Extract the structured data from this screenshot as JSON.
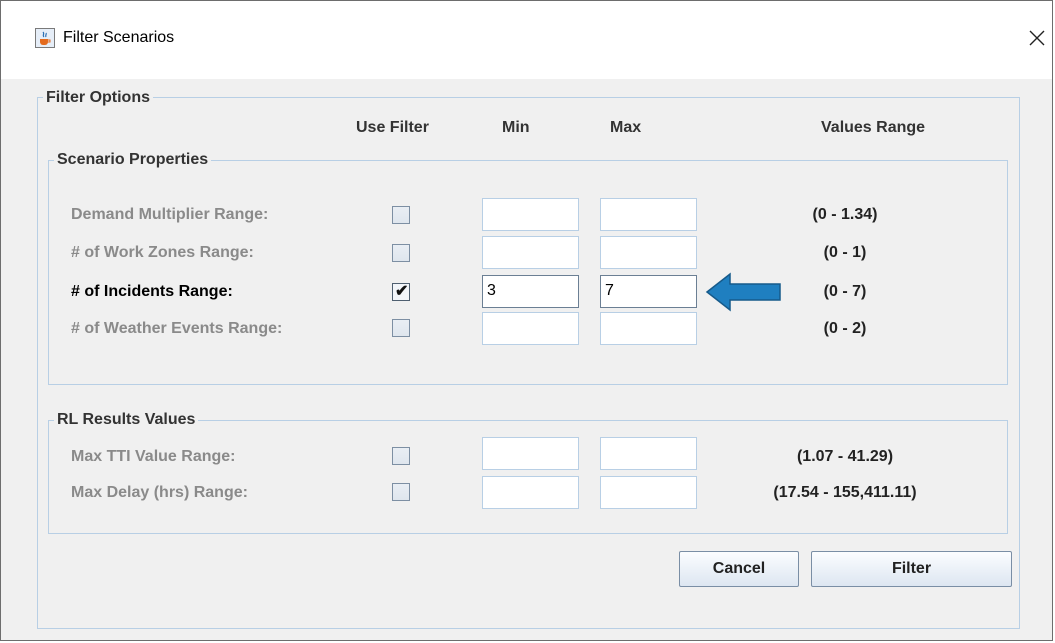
{
  "window": {
    "title": "Filter Scenarios"
  },
  "filter_options": {
    "legend": "Filter Options",
    "columns": {
      "use_filter": "Use Filter",
      "min": "Min",
      "max": "Max",
      "values_range": "Values Range"
    },
    "scenario_properties": {
      "legend": "Scenario Properties",
      "rows": [
        {
          "label": "Demand Multiplier Range:",
          "checked": false,
          "min": "",
          "max": "",
          "range": "(0 - 1.34)"
        },
        {
          "label": "# of Work Zones Range:",
          "checked": false,
          "min": "",
          "max": "",
          "range": "(0 - 1)"
        },
        {
          "label": "# of Incidents Range:",
          "checked": true,
          "min": "3",
          "max": "7",
          "range": "(0 - 7)"
        },
        {
          "label": "# of Weather Events Range:",
          "checked": false,
          "min": "",
          "max": "",
          "range": "(0 - 2)"
        }
      ]
    },
    "rl_results": {
      "legend": "RL Results Values",
      "rows": [
        {
          "label": "Max TTI Value Range:",
          "checked": false,
          "min": "",
          "max": "",
          "range": "(1.07 - 41.29)"
        },
        {
          "label": "Max Delay (hrs) Range:",
          "checked": false,
          "min": "",
          "max": "",
          "range": "(17.54 - 155,411.11)"
        }
      ]
    }
  },
  "buttons": {
    "cancel": "Cancel",
    "filter": "Filter"
  },
  "colors": {
    "arrow": "#1f7fc0",
    "arrow_outline": "#165a8a",
    "group_border": "#b8cfe5"
  },
  "icons": {
    "app": "java-cup-icon",
    "close": "close-icon",
    "annotation": "left-arrow-icon"
  }
}
